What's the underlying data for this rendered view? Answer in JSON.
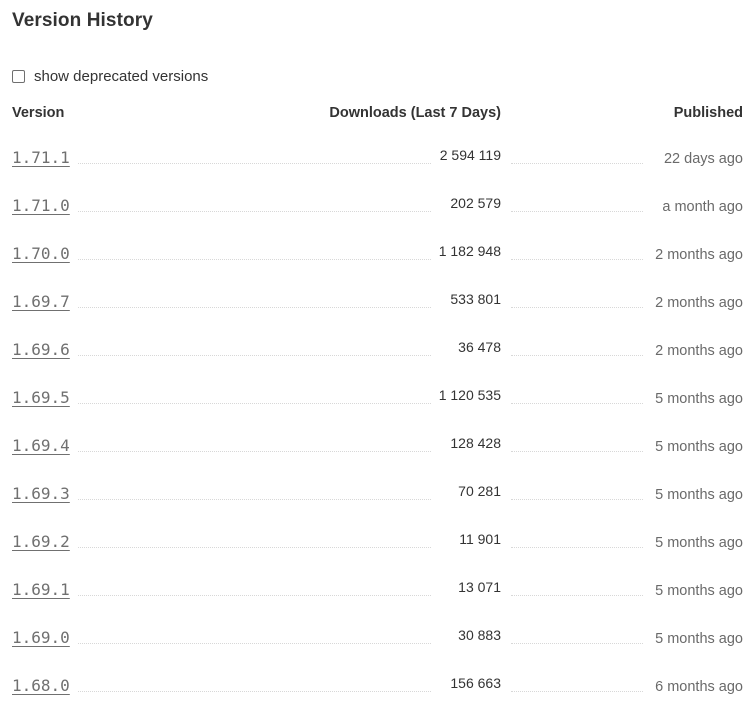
{
  "title": "Version History",
  "toggle": {
    "label": "show deprecated versions",
    "checked": false
  },
  "columns": {
    "version": "Version",
    "downloads": "Downloads (Last 7 Days)",
    "published": "Published"
  },
  "versions": [
    {
      "version": "1.71.1",
      "downloads": "2 594 119",
      "published": "22 days ago"
    },
    {
      "version": "1.71.0",
      "downloads": "202 579",
      "published": "a month ago"
    },
    {
      "version": "1.70.0",
      "downloads": "1 182 948",
      "published": "2 months ago"
    },
    {
      "version": "1.69.7",
      "downloads": "533 801",
      "published": "2 months ago"
    },
    {
      "version": "1.69.6",
      "downloads": "36 478",
      "published": "2 months ago"
    },
    {
      "version": "1.69.5",
      "downloads": "1 120 535",
      "published": "5 months ago"
    },
    {
      "version": "1.69.4",
      "downloads": "128 428",
      "published": "5 months ago"
    },
    {
      "version": "1.69.3",
      "downloads": "70 281",
      "published": "5 months ago"
    },
    {
      "version": "1.69.2",
      "downloads": "11 901",
      "published": "5 months ago"
    },
    {
      "version": "1.69.1",
      "downloads": "13 071",
      "published": "5 months ago"
    },
    {
      "version": "1.69.0",
      "downloads": "30 883",
      "published": "5 months ago"
    },
    {
      "version": "1.68.0",
      "downloads": "156 663",
      "published": "6 months ago"
    }
  ]
}
